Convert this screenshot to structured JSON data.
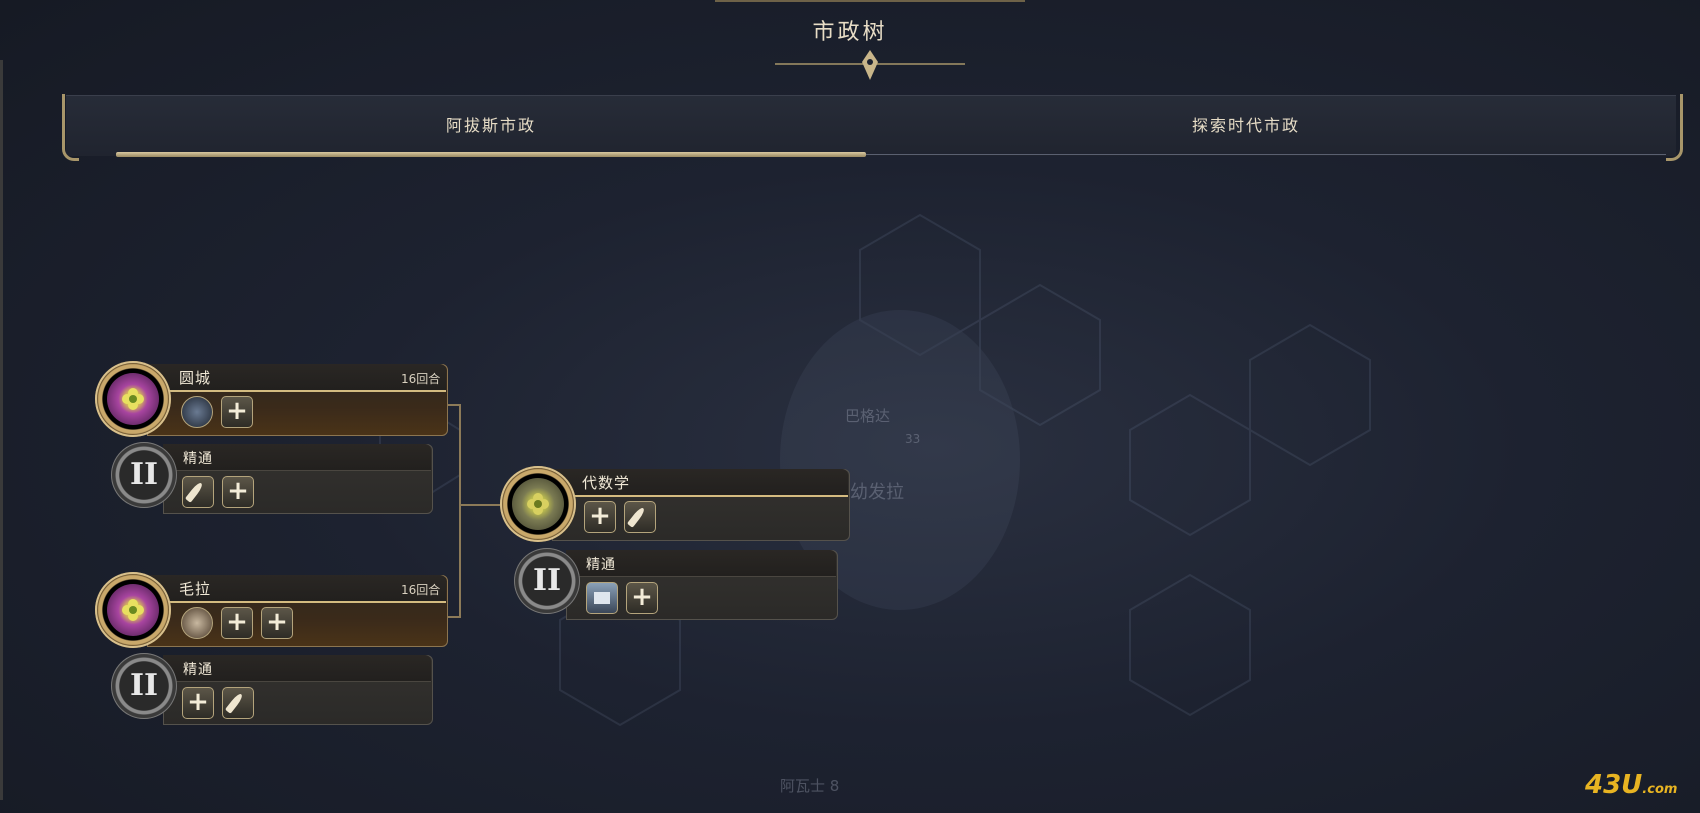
{
  "page": {
    "title": "市政树"
  },
  "tabs": [
    {
      "label": "阿拔斯市政",
      "active": true
    },
    {
      "label": "探索时代市政",
      "active": false
    }
  ],
  "map_labels": {
    "city": "巴格达",
    "city_value": "33",
    "river": "幼发拉",
    "bottom": "阿瓦士 8"
  },
  "tree": {
    "nodes": [
      {
        "name": "圆城",
        "turns": "16回合",
        "icons": [
          "globe-building-icon",
          "plus-icon"
        ]
      },
      {
        "name": "精通",
        "roman": "II",
        "icons": [
          "feather-icon",
          "plus-icon"
        ]
      },
      {
        "name": "毛拉",
        "turns": "16回合",
        "icons": [
          "gate-building-icon",
          "plus-icon",
          "plus-icon"
        ]
      },
      {
        "name": "精通",
        "roman": "II",
        "icons": [
          "plus-icon",
          "feather-icon"
        ]
      },
      {
        "name": "代数学",
        "icons": [
          "plus-icon",
          "feather-icon"
        ]
      },
      {
        "name": "精通",
        "roman": "II",
        "icons": [
          "building-icon",
          "plus-icon"
        ]
      }
    ],
    "plus_glyph": "+"
  },
  "watermark": {
    "text": "43U",
    "suffix": ".com"
  },
  "colors": {
    "gold": "#c9a86a",
    "background": "#1d2230"
  }
}
